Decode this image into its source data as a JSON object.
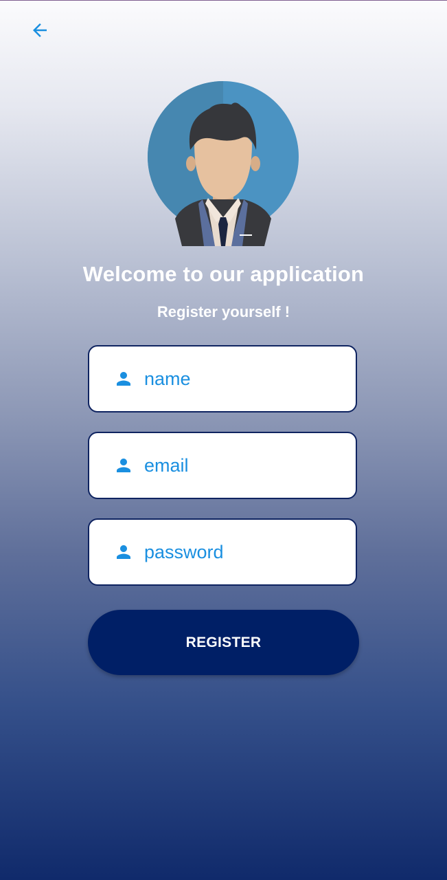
{
  "header": {
    "back_icon": "arrow-left-icon"
  },
  "avatar": {
    "icon": "user-avatar-illustration"
  },
  "welcome": {
    "title": "Welcome to our application",
    "subtitle": "Register yourself !"
  },
  "form": {
    "name": {
      "placeholder": "name",
      "value": "",
      "icon": "person-icon"
    },
    "email": {
      "placeholder": "email",
      "value": "",
      "icon": "person-icon"
    },
    "password": {
      "placeholder": "password",
      "value": "",
      "icon": "person-icon"
    }
  },
  "actions": {
    "register_label": "REGISTER"
  },
  "colors": {
    "accent": "#1a8fe0",
    "primary": "#001f66",
    "field_border": "#0e2360"
  }
}
